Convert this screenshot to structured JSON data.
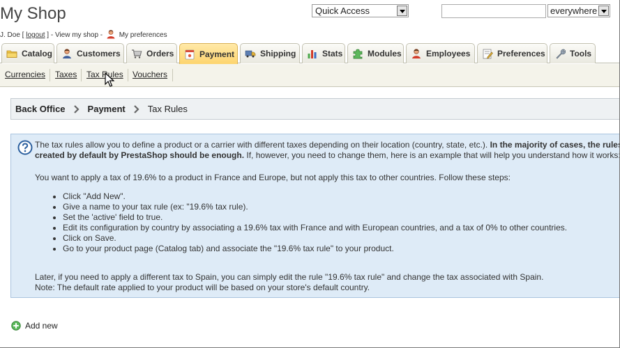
{
  "header": {
    "shop_title": "My Shop",
    "user_prefix": "J. Doe [",
    "logout": "logout",
    "user_mid": "] - View my shop -",
    "preferences_link": "My preferences",
    "quick_access": "Quick Access",
    "search_value": "",
    "search_scope": "everywhere"
  },
  "tabs": [
    {
      "label": "Catalog",
      "icon": "folder-icon"
    },
    {
      "label": "Customers",
      "icon": "customer-icon"
    },
    {
      "label": "Orders",
      "icon": "cart-icon"
    },
    {
      "label": "Payment",
      "icon": "payment-icon",
      "active": true
    },
    {
      "label": "Shipping",
      "icon": "truck-icon"
    },
    {
      "label": "Stats",
      "icon": "stats-icon"
    },
    {
      "label": "Modules",
      "icon": "puzzle-icon"
    },
    {
      "label": "Employees",
      "icon": "employee-icon"
    },
    {
      "label": "Preferences",
      "icon": "preferences-icon"
    },
    {
      "label": "Tools",
      "icon": "wrench-icon"
    }
  ],
  "subnav": [
    "Currencies",
    "Taxes",
    "Tax Rules",
    "Vouchers"
  ],
  "breadcrumb": [
    "Back Office",
    "Payment",
    "Tax Rules"
  ],
  "hint": {
    "intro_1": "The tax rules allow you to define a product or a carrier with different taxes depending on their location (country, state, etc.).",
    "intro_bold_1": "In the majority of cases, the rules",
    "intro_bold_2": "created by default by PrestaShop should be enough.",
    "intro_2": "If, however, you need to change them, here is an example that will help you understand how it works:",
    "example": "You want to apply a tax of 19.6% to a product in France and Europe, but not apply this tax to other countries. Follow these steps:",
    "steps": [
      "Click \"Add New\".",
      "Give a name to your tax rule (ex: \"19.6% tax rule).",
      "Set the 'active' field to true.",
      "Edit its configuration by country by associating a 19.6% tax with France and with European countries, and a tax of 0% to other countries.",
      "Click on Save.",
      "Go to your product page (Catalog tab) and associate the \"19.6% tax rule\" to your product."
    ],
    "later": "Later, if you need to apply a different tax to Spain, you can simply edit the rule \"19.6% tax rule\" and change the tax associated with Spain.",
    "note": "Note: The default rate applied to your product will be based on your store's default country."
  },
  "add_new": "Add new",
  "colors": {
    "active_tab": "#fdd46e",
    "hint_bg": "#deebf7",
    "breadcrumb_bg": "#eef1f3",
    "subnav_bg": "#f4f3ea"
  }
}
